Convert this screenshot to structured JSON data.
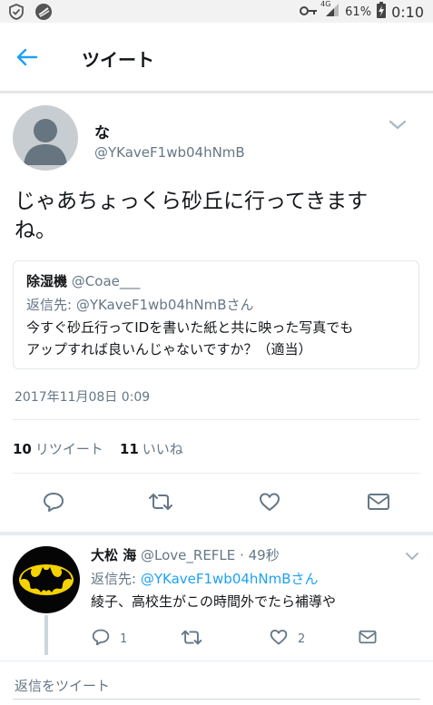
{
  "status_bar": {
    "network": "4G",
    "battery": "61%",
    "time": "0:10"
  },
  "header": {
    "title": "ツイート"
  },
  "tweet": {
    "author_name": "な",
    "author_handle": "@YKaveF1wb04hNmB",
    "text_line1": "じゃあちょっくら砂丘に行ってきます",
    "text_line2": "ね。",
    "quote": {
      "name": "除湿機",
      "handle": "@Coae___",
      "reply_to": "返信先: @YKaveF1wb04hNmBさん",
      "text_line1": "今すぐ砂丘行ってIDを書いた紙と共に映った写真でも",
      "text_line2": "アップすれば良いんじゃないですか？（適当）"
    },
    "timestamp": "2017年11月08日 0:09",
    "retweets_count": "10",
    "retweets_label": "リツイート",
    "likes_count": "11",
    "likes_label": "いいね"
  },
  "reply": {
    "name": "大松 海",
    "handle": "@Love_REFLE",
    "separator": "·",
    "time": "49秒",
    "reply_prefix": "返信先: ",
    "reply_link": "@YKaveF1wb04hNmBさん",
    "text": "綾子、高校生がこの時間外でたら補導や",
    "reply_count": "1",
    "like_count": "2"
  },
  "compose": {
    "placeholder": "返信をツイート"
  },
  "colors": {
    "accent": "#1da1f2",
    "text": "#14171a",
    "secondary": "#657786"
  }
}
